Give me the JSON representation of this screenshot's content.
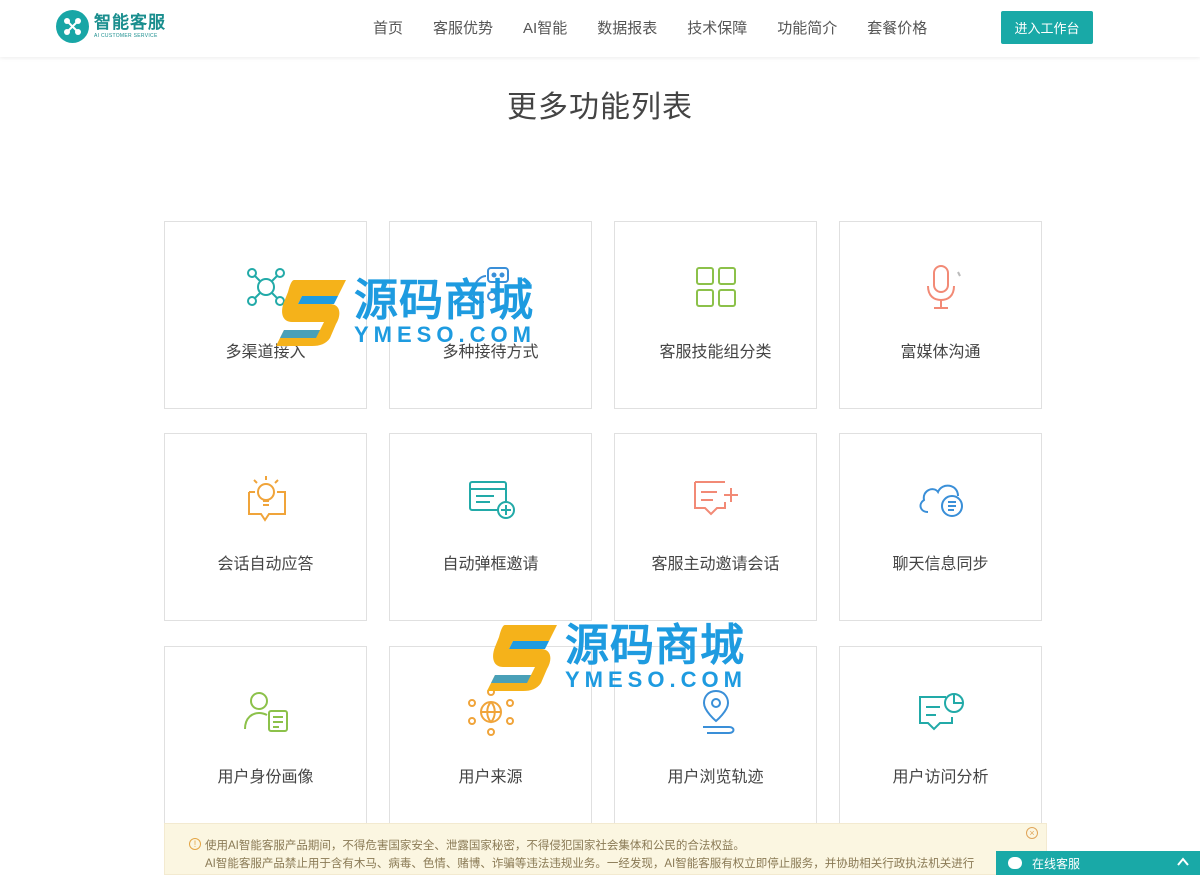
{
  "header": {
    "logo_title": "智能客服",
    "logo_sub": "AI CUSTOMER SERVICE",
    "nav": [
      "首页",
      "客服优势",
      "AI智能",
      "数据报表",
      "技术保障",
      "功能简介",
      "套餐价格"
    ],
    "cta_label": "进入工作台"
  },
  "section": {
    "title": "更多功能列表"
  },
  "features": [
    {
      "label": "多渠道接入",
      "icon": "network-icon",
      "color": "#22aaa8"
    },
    {
      "label": "多种接待方式",
      "icon": "robot-chat-icon",
      "color": "#3a8fd8"
    },
    {
      "label": "客服技能组分类",
      "icon": "grid-icon",
      "color": "#8cc14a"
    },
    {
      "label": "富媒体沟通",
      "icon": "microphone-icon",
      "color": "#f28a76"
    },
    {
      "label": "会话自动应答",
      "icon": "lightbulb-icon",
      "color": "#f0a43a"
    },
    {
      "label": "自动弹框邀请",
      "icon": "window-plus-icon",
      "color": "#22aaa8"
    },
    {
      "label": "客服主动邀请会话",
      "icon": "message-plus-icon",
      "color": "#f28a76"
    },
    {
      "label": "聊天信息同步",
      "icon": "cloud-sync-icon",
      "color": "#3a8fd8"
    },
    {
      "label": "用户身份画像",
      "icon": "user-id-icon",
      "color": "#8cc14a"
    },
    {
      "label": "用户来源",
      "icon": "globe-network-icon",
      "color": "#f0a43a"
    },
    {
      "label": "用户浏览轨迹",
      "icon": "location-track-icon",
      "color": "#3a8fd8"
    },
    {
      "label": "用户访问分析",
      "icon": "chart-message-icon",
      "color": "#22aaa8"
    }
  ],
  "watermark": {
    "cn": "源码商城",
    "en": "YMESO.COM"
  },
  "notice": {
    "line1": "使用AI智能客服产品期间，不得危害国家安全、泄露国家秘密，不得侵犯国家社会集体和公民的合法权益。",
    "line2": "AI智能客服产品禁止用于含有木马、病毒、色情、赌博、诈骗等违法违规业务。一经发现，AI智能客服有权立即停止服务，并协助相关行政执法机关进行"
  },
  "chat": {
    "label": "在线客服"
  },
  "colors": {
    "brand": "#19a9a7",
    "watermark": "#1e9be0"
  }
}
